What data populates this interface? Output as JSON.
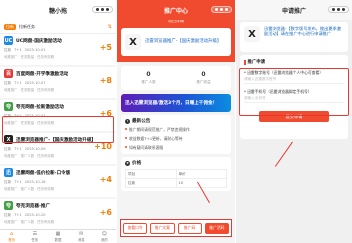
{
  "panel1": {
    "title": "糖小拖",
    "capsule": "•••",
    "header": {
      "badge": "拉新",
      "label": "拉新任务",
      "toggle": "⇅"
    },
    "tasks": [
      {
        "icon": "UC",
        "icon_color": "#1e88e5",
        "name": "UC网盘-国庆激励活动",
        "reward": "+5",
        "meta": [
          "拉新",
          "T+1",
          "2025-10-01"
        ],
        "meta2": [
          "地推推广",
          "任务数量",
          "任务有效期"
        ]
      },
      {
        "icon": "百",
        "icon_color": "#e53935",
        "name": "百度网盘-开学季激励活动",
        "reward": "+8",
        "meta": [
          "拉新",
          "T+1",
          "2025-10-07"
        ],
        "meta2": [
          "地推推广",
          "任务数量",
          "任务有效期"
        ]
      },
      {
        "icon": "夸",
        "icon_color": "#43a047",
        "name": "夸克网盘-拉新激励活动",
        "reward": "+6",
        "meta": [
          "拉新",
          "T+1",
          "2025-10-07"
        ],
        "meta2": [
          "地推推广",
          "任务数量",
          "任务有效期"
        ]
      },
      {
        "icon": "X",
        "icon_color": "#222222",
        "name": "迅雷浏览器推广-【国庆激励活动升级】",
        "reward": "+10",
        "meta": [
          "拉新",
          "T+1",
          "2025-10-09"
        ],
        "meta2": [
          "地推推广",
          "推广人数",
          "任务有效期"
        ]
      },
      {
        "icon": "迅",
        "icon_color": "#1e88e5",
        "name": "迅雷网盘-低价拉新-口令版",
        "reward": "+4",
        "meta": [
          "拉新",
          "T+1",
          "2025-10-16"
        ],
        "meta2": [
          "地推推广",
          "推广人数",
          "任务有效期"
        ]
      },
      {
        "icon": "夸",
        "icon_color": "#43a047",
        "name": "夸克浏览器-推广",
        "reward": "+6",
        "meta": [
          "拉新",
          "T+1",
          "2025-10-20"
        ],
        "meta2": [
          "地推推广",
          "推广人数",
          "任务有效期"
        ]
      }
    ],
    "tabs": [
      {
        "g": "⌂",
        "label": "首页"
      },
      {
        "g": "☰",
        "label": "任务"
      },
      {
        "g": "▦",
        "label": "数据"
      },
      {
        "g": "✉",
        "label": "消息"
      },
      {
        "g": "☺",
        "label": "我的"
      }
    ]
  },
  "panel2": {
    "title": "推广中心",
    "subtitle": "项目详情",
    "capsule": "•••",
    "card_logo": "X",
    "card_name": "迅雷浏览器推广-【国庆激励活动升级】",
    "stats": [
      {
        "v": "0",
        "l": "推广人数"
      },
      {
        "v": "0",
        "l": "推广收益"
      }
    ],
    "banner": "迅入迅雷浏览器/激活3个月，日赚上千佣金！",
    "notice_title": "最新公告",
    "notices": [
      "推广期间请规范推广，严禁违规操作",
      "收益数据T+1更新，请耐心等待",
      "如有疑问请联系客服"
    ],
    "rule_title": "价格",
    "table": [
      [
        "项目",
        "单价"
      ],
      [
        "拉新",
        "10"
      ]
    ],
    "buttons": [
      "查看口令",
      "推广文案",
      "推广码",
      "推广活码"
    ]
  },
  "panel3": {
    "title": "申请推广",
    "capsule": "•••",
    "card_logo": "X",
    "card_name": "迅雷浏览器-【数字版号发布，推出夏季激励活动】请在推广中心进行申请推广",
    "form_title": "推广申请",
    "fields": [
      {
        "label": "* 迅雷数字账号（迅雷浏览器个人中心可查看）",
        "placeholder": "请输入迅雷数字账号"
      },
      {
        "label": "* 迅雷手机号（迅雷浏览器绑定手机号）",
        "placeholder": "请输入手机号"
      }
    ],
    "submit": "提交申请"
  }
}
